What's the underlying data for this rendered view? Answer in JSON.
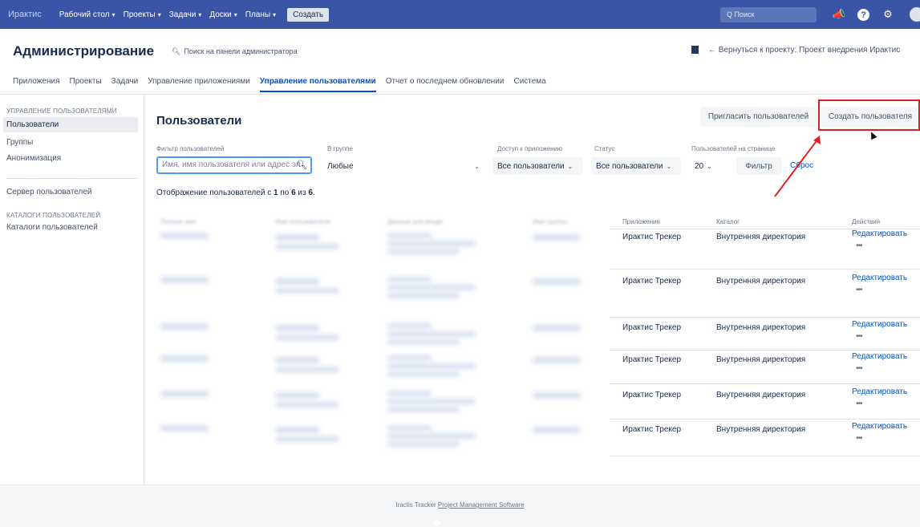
{
  "topnav": {
    "logo": "Ирактис",
    "items": [
      {
        "label": "Рабочий стол"
      },
      {
        "label": "Проекты"
      },
      {
        "label": "Задачи"
      },
      {
        "label": "Доски"
      },
      {
        "label": "Планы"
      }
    ],
    "create_label": "Создать",
    "search_placeholder": "Q Поиск",
    "icons": [
      "megaphone-icon",
      "help-icon",
      "gear-icon",
      "avatar"
    ]
  },
  "header": {
    "title": "Администрирование",
    "admin_search": "Поиск на панели администратора",
    "back_link": "Вернуться к проекту: Проект внедрения Ирактис"
  },
  "tabs": [
    {
      "label": "Приложения"
    },
    {
      "label": "Проекты"
    },
    {
      "label": "Задачи"
    },
    {
      "label": "Управление приложениями"
    },
    {
      "label": "Управление пользователями",
      "active": true
    },
    {
      "label": "Отчет о последнем обновлении"
    },
    {
      "label": "Система"
    }
  ],
  "sidebar": {
    "heading_users": "УПРАВЛЕНИЕ ПОЛЬЗОВАТЕЛЯМИ",
    "item_users": "Пользователи",
    "item_groups": "Группы",
    "item_anon": "Анонимизация",
    "item_server": "Сервер пользователей",
    "heading_catalogs": "КАТАЛОГИ ПОЛЬЗОВАТЕЛЕЙ",
    "item_catalogs": "Каталоги пользователей"
  },
  "main": {
    "title": "Пользователи",
    "invite_label": "Пригласить пользователей",
    "create_user_label": "Создать пользователя",
    "filters": {
      "user_filter_label": "Фильтр пользователей",
      "user_filter_placeholder": "Имя, имя пользователя или адрес эл",
      "group_label": "В группе",
      "group_value": "Любые",
      "access_label": "Доступ к приложению",
      "access_value": "Все пользователи",
      "status_label": "Статус",
      "status_value": "Все пользователи",
      "per_page_label": "Пользователей на странице",
      "per_page_value": "20",
      "filter_button": "Фильтр",
      "reset_link": "Сброс"
    },
    "count": {
      "prefix": "Отображение пользователей с ",
      "from": "1",
      "mid": " по ",
      "to": "6",
      "mid2": " из ",
      "total": "6",
      "suffix": "."
    },
    "table": {
      "headers": {
        "full_name": "Полное имя",
        "username": "Имя пользователя",
        "login": "Данные для входа",
        "groups": "Имя группы",
        "apps": "Приложения",
        "directory": "Каталог",
        "actions": "Действия"
      },
      "rows": [
        {
          "app": "Ирактис Трекер",
          "directory": "Внутренняя директория",
          "edit": "Редактировать",
          "more": "•••"
        },
        {
          "app": "Ирактис Трекер",
          "directory": "Внутренняя директория",
          "edit": "Редактировать",
          "more": "•••"
        },
        {
          "app": "Ирактис Трекер",
          "directory": "Внутренняя директория",
          "edit": "Редактировать",
          "more": "•••"
        },
        {
          "app": "Ирактис Трекер",
          "directory": "Внутренняя директория",
          "edit": "Редактировать",
          "more": "•••"
        },
        {
          "app": "Ирактис Трекер",
          "directory": "Внутренняя директория",
          "edit": "Редактировать",
          "more": "•••"
        },
        {
          "app": "Ирактис Трекер",
          "directory": "Внутренняя директория",
          "edit": "Редактировать",
          "more": "•••"
        }
      ]
    }
  },
  "footer": {
    "prefix": "Iractis Tracker ",
    "link": "Project Management Software"
  },
  "colors": {
    "topnav": "#3a55a6",
    "link": "#0052cc",
    "highlight": "#e02020"
  }
}
